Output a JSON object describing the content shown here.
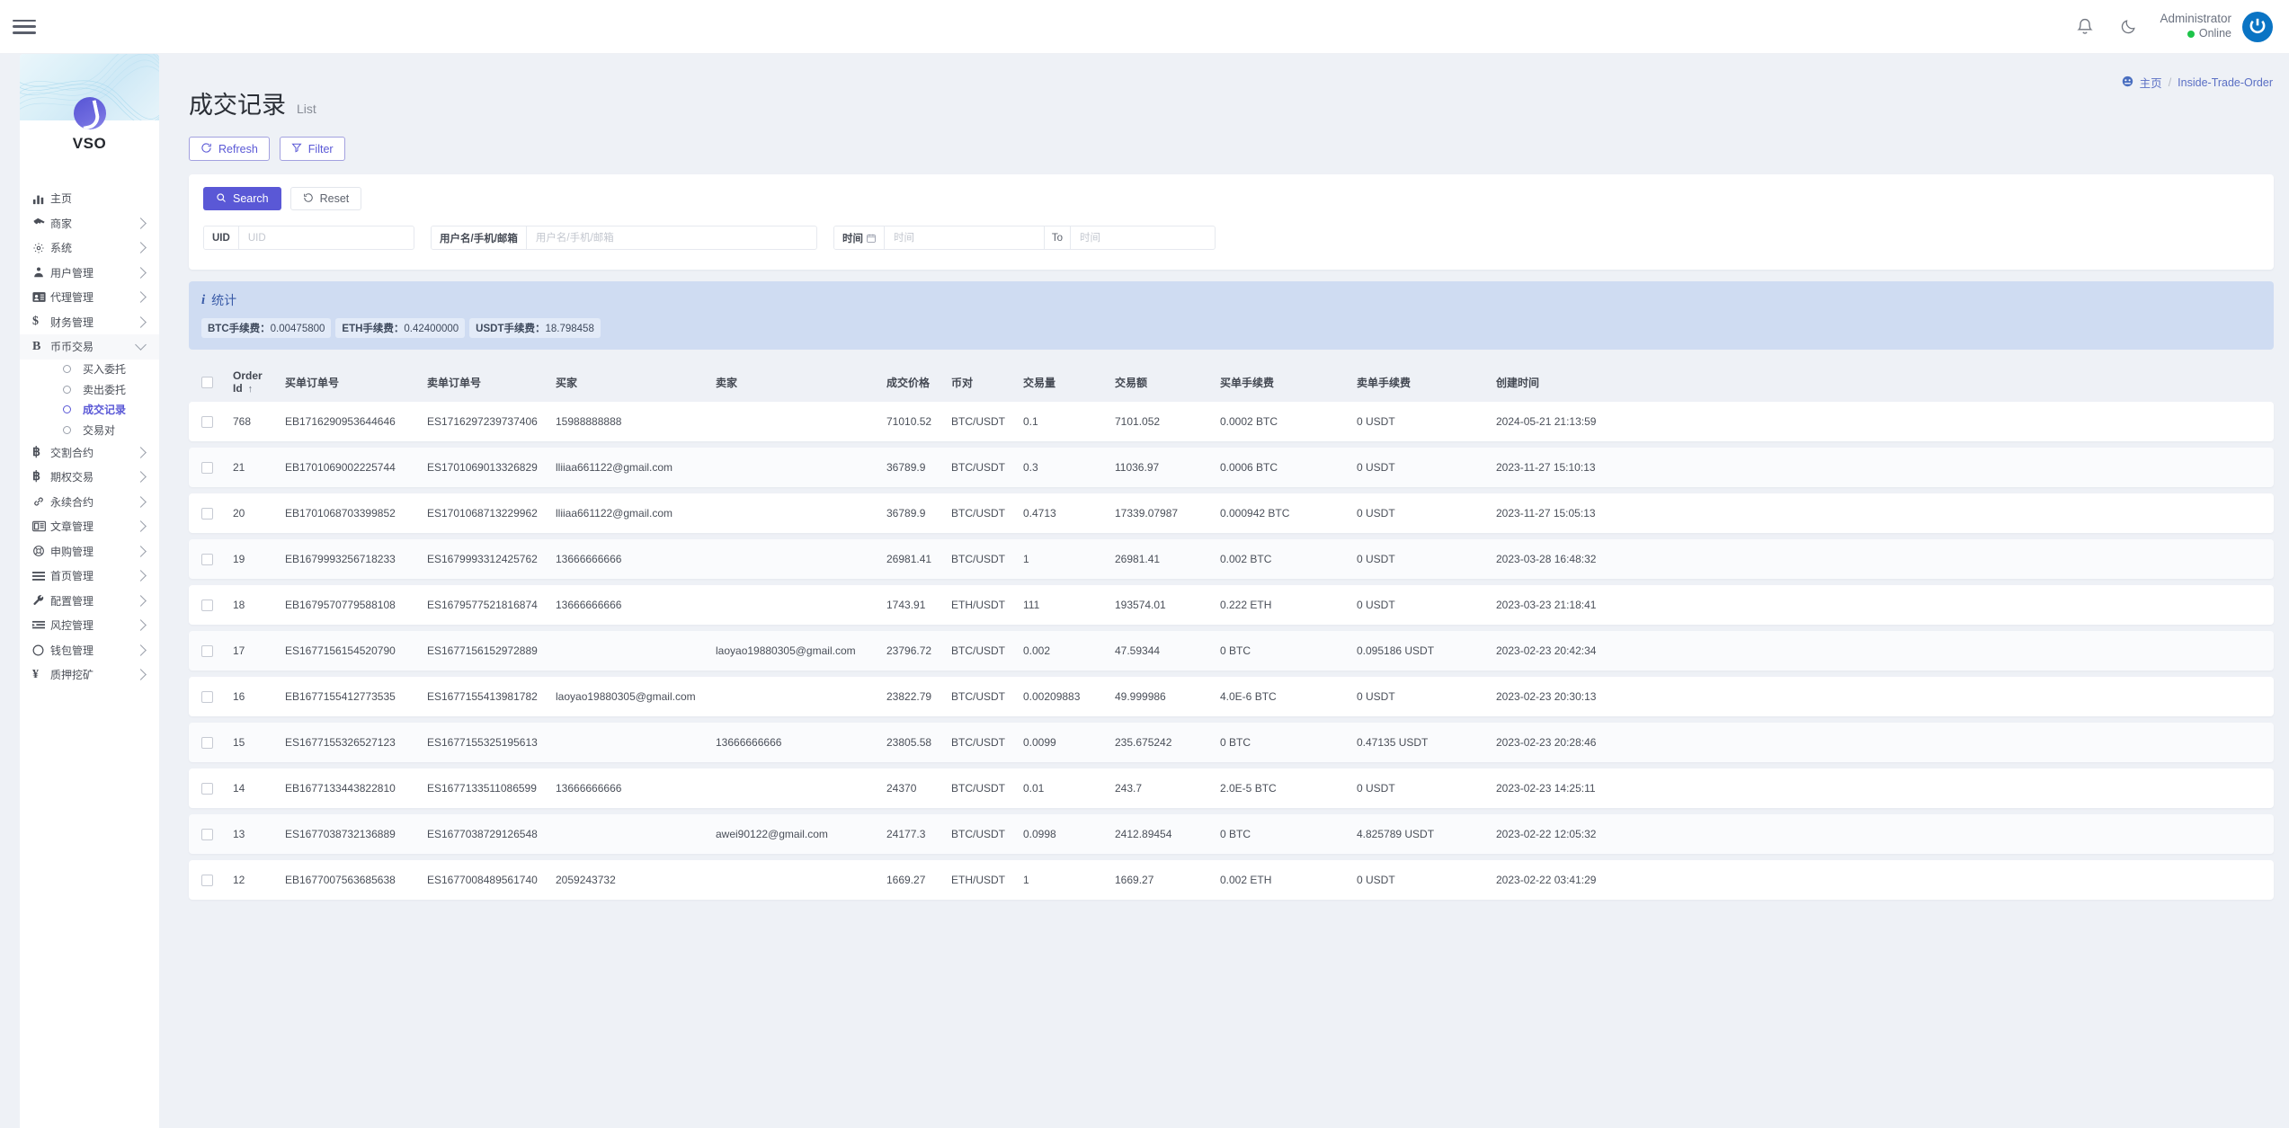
{
  "topbar": {
    "menu_toggle": "menu-toggle",
    "bell": "notification-bell",
    "theme": "dark-mode-toggle",
    "user_name": "Administrator",
    "user_status": "Online"
  },
  "breadcrumb": {
    "home": "主页",
    "separator": "/",
    "current": "Inside-Trade-Order"
  },
  "page": {
    "title": "成交记录",
    "subtitle": "List"
  },
  "toolbar": {
    "refresh_label": "Refresh",
    "filter_label": "Filter"
  },
  "search": {
    "search_label": "Search",
    "reset_label": "Reset",
    "uid_label": "UID",
    "uid_placeholder": "UID",
    "uid_value": "",
    "user_label": "用户名/手机/邮箱",
    "user_placeholder": "用户名/手机/邮箱",
    "user_value": "",
    "time_label": "时间",
    "time_from_placeholder": "时间",
    "time_from_value": "",
    "time_to_separator": "To",
    "time_to_placeholder": "时间",
    "time_to_value": ""
  },
  "stats": {
    "title": "统计",
    "tags": [
      {
        "label": "BTC手续费：",
        "value": "0.00475800"
      },
      {
        "label": "ETH手续费：",
        "value": "0.42400000"
      },
      {
        "label": "USDT手续费：",
        "value": "18.798458"
      }
    ]
  },
  "sidebar": {
    "brand": "VSO",
    "items": [
      {
        "label": "主页",
        "icon": "bar-chart-icon",
        "chevron": false
      },
      {
        "label": "商家",
        "icon": "store-icon",
        "chevron": true
      },
      {
        "label": "系统",
        "icon": "gear-icon",
        "chevron": true
      },
      {
        "label": "用户管理",
        "icon": "users-icon",
        "chevron": true
      },
      {
        "label": "代理管理",
        "icon": "id-card-icon",
        "chevron": true
      },
      {
        "label": "财务管理",
        "icon": "dollar-icon",
        "chevron": true
      },
      {
        "label": "币币交易",
        "icon": "letter-b-icon",
        "chevron": true,
        "expanded": true,
        "children": [
          {
            "label": "买入委托",
            "active": false
          },
          {
            "label": "卖出委托",
            "active": false
          },
          {
            "label": "成交记录",
            "active": true
          },
          {
            "label": "交易对",
            "active": false
          }
        ]
      },
      {
        "label": "交割合约",
        "icon": "bitcoin-icon",
        "chevron": true
      },
      {
        "label": "期权交易",
        "icon": "bitcoin-icon",
        "chevron": true
      },
      {
        "label": "永续合约",
        "icon": "link-icon",
        "chevron": true
      },
      {
        "label": "文章管理",
        "icon": "news-icon",
        "chevron": true
      },
      {
        "label": "申购管理",
        "icon": "lifebuoy-icon",
        "chevron": true
      },
      {
        "label": "首页管理",
        "icon": "list-icon",
        "chevron": true
      },
      {
        "label": "配置管理",
        "icon": "wrench-icon",
        "chevron": true
      },
      {
        "label": "风控管理",
        "icon": "indent-icon",
        "chevron": true
      },
      {
        "label": "钱包管理",
        "icon": "circle-icon",
        "chevron": true
      },
      {
        "label": "质押挖矿",
        "icon": "yen-icon",
        "chevron": true
      }
    ]
  },
  "table": {
    "columns": [
      "Order Id",
      "买单订单号",
      "卖单订单号",
      "买家",
      "卖家",
      "成交价格",
      "币对",
      "交易量",
      "交易额",
      "买单手续费",
      "卖单手续费",
      "创建时间"
    ],
    "sort_column": "Order Id",
    "sort_direction": "↑",
    "rows": [
      {
        "id": "768",
        "buy_order": "EB1716290953644646",
        "sell_order": "ES1716297239737406",
        "buyer": "15988888888",
        "seller": "",
        "price": "71010.52",
        "pair": "BTC/USDT",
        "volume": "0.1",
        "amount": "7101.052",
        "buy_fee": "0.0002 BTC",
        "sell_fee": "0 USDT",
        "time": "2024-05-21 21:13:59"
      },
      {
        "id": "21",
        "buy_order": "EB1701069002225744",
        "sell_order": "ES1701069013326829",
        "buyer": "lliiaa661122@gmail.com",
        "seller": "",
        "price": "36789.9",
        "pair": "BTC/USDT",
        "volume": "0.3",
        "amount": "11036.97",
        "buy_fee": "0.0006 BTC",
        "sell_fee": "0 USDT",
        "time": "2023-11-27 15:10:13"
      },
      {
        "id": "20",
        "buy_order": "EB1701068703399852",
        "sell_order": "ES1701068713229962",
        "buyer": "lliiaa661122@gmail.com",
        "seller": "",
        "price": "36789.9",
        "pair": "BTC/USDT",
        "volume": "0.4713",
        "amount": "17339.07987",
        "buy_fee": "0.000942 BTC",
        "sell_fee": "0 USDT",
        "time": "2023-11-27 15:05:13"
      },
      {
        "id": "19",
        "buy_order": "EB1679993256718233",
        "sell_order": "ES1679993312425762",
        "buyer": "13666666666",
        "seller": "",
        "price": "26981.41",
        "pair": "BTC/USDT",
        "volume": "1",
        "amount": "26981.41",
        "buy_fee": "0.002 BTC",
        "sell_fee": "0 USDT",
        "time": "2023-03-28 16:48:32"
      },
      {
        "id": "18",
        "buy_order": "EB1679570779588108",
        "sell_order": "ES1679577521816874",
        "buyer": "13666666666",
        "seller": "",
        "price": "1743.91",
        "pair": "ETH/USDT",
        "volume": "111",
        "amount": "193574.01",
        "buy_fee": "0.222 ETH",
        "sell_fee": "0 USDT",
        "time": "2023-03-23 21:18:41"
      },
      {
        "id": "17",
        "buy_order": "ES1677156154520790",
        "sell_order": "ES1677156152972889",
        "buyer": "",
        "seller": "laoyao19880305@gmail.com",
        "price": "23796.72",
        "pair": "BTC/USDT",
        "volume": "0.002",
        "amount": "47.59344",
        "buy_fee": "0 BTC",
        "sell_fee": "0.095186 USDT",
        "time": "2023-02-23 20:42:34"
      },
      {
        "id": "16",
        "buy_order": "EB1677155412773535",
        "sell_order": "ES1677155413981782",
        "buyer": "laoyao19880305@gmail.com",
        "seller": "",
        "price": "23822.79",
        "pair": "BTC/USDT",
        "volume": "0.00209883",
        "amount": "49.999986",
        "buy_fee": "4.0E-6 BTC",
        "sell_fee": "0 USDT",
        "time": "2023-02-23 20:30:13"
      },
      {
        "id": "15",
        "buy_order": "ES1677155326527123",
        "sell_order": "ES1677155325195613",
        "buyer": "",
        "seller": "13666666666",
        "price": "23805.58",
        "pair": "BTC/USDT",
        "volume": "0.0099",
        "amount": "235.675242",
        "buy_fee": "0 BTC",
        "sell_fee": "0.47135 USDT",
        "time": "2023-02-23 20:28:46"
      },
      {
        "id": "14",
        "buy_order": "EB1677133443822810",
        "sell_order": "ES1677133511086599",
        "buyer": "13666666666",
        "seller": "",
        "price": "24370",
        "pair": "BTC/USDT",
        "volume": "0.01",
        "amount": "243.7",
        "buy_fee": "2.0E-5 BTC",
        "sell_fee": "0 USDT",
        "time": "2023-02-23 14:25:11"
      },
      {
        "id": "13",
        "buy_order": "ES1677038732136889",
        "sell_order": "ES1677038729126548",
        "buyer": "",
        "seller": "awei90122@gmail.com",
        "price": "24177.3",
        "pair": "BTC/USDT",
        "volume": "0.0998",
        "amount": "2412.89454",
        "buy_fee": "0 BTC",
        "sell_fee": "4.825789 USDT",
        "time": "2023-02-22 12:05:32"
      },
      {
        "id": "12",
        "buy_order": "EB1677007563685638",
        "sell_order": "ES1677008489561740",
        "buyer": "2059243732",
        "seller": "",
        "price": "1669.27",
        "pair": "ETH/USDT",
        "volume": "1",
        "amount": "1669.27",
        "buy_fee": "0.002 ETH",
        "sell_fee": "0 USDT",
        "time": "2023-02-22 03:41:29"
      }
    ]
  },
  "colors": {
    "accent": "#5a58d6",
    "stat_bg": "#cfdcf2",
    "page_bg": "#eef1f6",
    "online": "#1ec44a"
  }
}
